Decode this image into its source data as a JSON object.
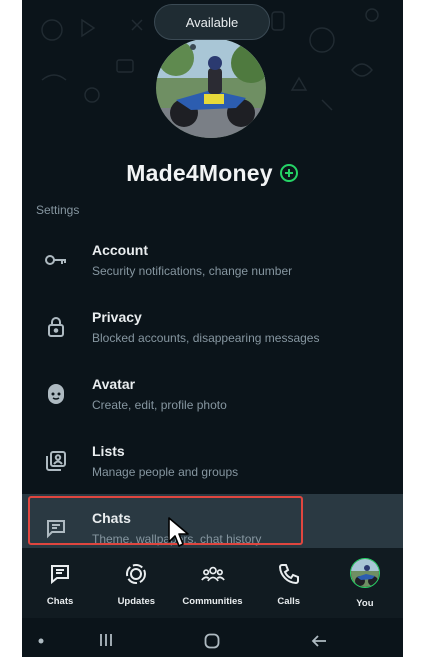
{
  "status_tooltip": "Available",
  "profile": {
    "name": "Made4Money"
  },
  "section_label": "Settings",
  "settings": [
    {
      "title": "Account",
      "subtitle": "Security notifications, change number",
      "icon": "key-icon"
    },
    {
      "title": "Privacy",
      "subtitle": "Blocked accounts, disappearing messages",
      "icon": "lock-icon"
    },
    {
      "title": "Avatar",
      "subtitle": "Create, edit, profile photo",
      "icon": "avatar-face-icon"
    },
    {
      "title": "Lists",
      "subtitle": "Manage people and groups",
      "icon": "lists-icon"
    },
    {
      "title": "Chats",
      "subtitle": "Theme, wallpapers, chat history",
      "icon": "chat-icon"
    }
  ],
  "bottom_nav": [
    {
      "label": "Chats",
      "icon": "chats-icon"
    },
    {
      "label": "Updates",
      "icon": "updates-icon"
    },
    {
      "label": "Communities",
      "icon": "communities-icon"
    },
    {
      "label": "Calls",
      "icon": "phone-icon"
    },
    {
      "label": "You",
      "icon": "avatar"
    }
  ],
  "colors": {
    "background": "#0b141a",
    "accent": "#25d366",
    "highlight": "#e0463f",
    "secondary_text": "#8696a0"
  }
}
